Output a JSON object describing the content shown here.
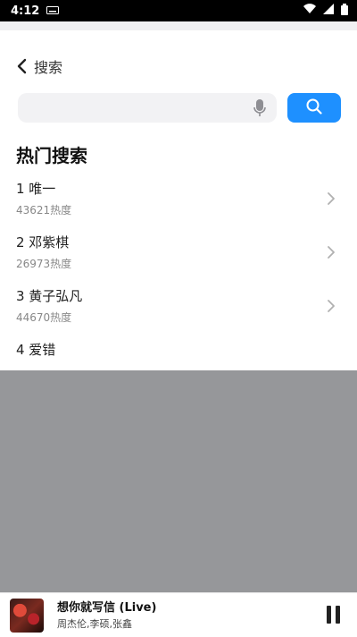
{
  "status_bar": {
    "time": "4:12",
    "icons": [
      "keyboard-icon",
      "wifi-icon",
      "signal-icon",
      "battery-icon"
    ]
  },
  "header": {
    "back_icon": "chevron-left-icon",
    "title": "搜索"
  },
  "search": {
    "value": "",
    "placeholder": "",
    "mic_icon": "microphone-icon",
    "button_icon": "search-icon",
    "button_color": "#1e90ff"
  },
  "hot_search": {
    "title": "热门搜索",
    "items": [
      {
        "name": "1 唯一",
        "heat": "43621热度"
      },
      {
        "name": "2 邓紫棋",
        "heat": "26973热度"
      },
      {
        "name": "3 黄子弘凡",
        "heat": "44670热度"
      },
      {
        "name": "4 爱错",
        "heat": ""
      }
    ]
  },
  "player": {
    "song": "想你就写信 (Live)",
    "artist": "周杰伦,李硕,张鑫",
    "control_icon": "pause-icon"
  }
}
